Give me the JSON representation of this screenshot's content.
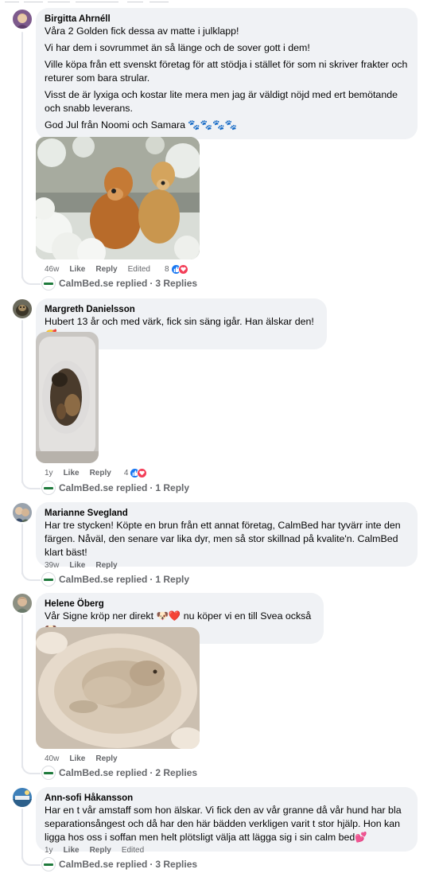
{
  "colors": {
    "bubble": "#f0f2f5",
    "meta": "#65676b",
    "like_blue": "#1877f2",
    "love_red": "#f33e58",
    "brand_green": "#1f7a3c"
  },
  "comments": [
    {
      "author": "Birgitta Ahrnéll",
      "paragraphs": [
        "Våra 2 Golden fick dessa av matte i julklapp!",
        "Vi har dem i sovrummet än så länge och de sover gott i dem!",
        "Ville köpa från ett svenskt företag för att stödja i stället för som ni skriver frakter och returer som bara strular.",
        "Visst de är lyxiga och kostar lite mera men jag är väldigt nöjd med ert bemötande och snabb leverans.",
        "God Jul från Noomi och Samara 🐾🐾🐾🐾"
      ],
      "photo": "two-golden-retrievers-in-snow",
      "age": "46w",
      "like": "Like",
      "reply": "Reply",
      "edited": "Edited",
      "reactions": "8",
      "replied_by": "CalmBed.se replied",
      "replies": "3 Replies"
    },
    {
      "author": "Margreth Danielsson",
      "paragraphs": [
        "Hubert 13 år och med värk, fick sin säng igår. Han älskar den!🥰"
      ],
      "photo": "dog-sleeping-on-bed",
      "age": "1y",
      "like": "Like",
      "reply": "Reply",
      "reactions": "4",
      "replied_by": "CalmBed.se replied",
      "replies": "1 Reply"
    },
    {
      "author": "Marianne Svegland",
      "paragraphs": [
        "Har tre stycken! Köpte en brun från ett annat företag, CalmBed har tyvärr inte den färgen. Nåväl, den senare var lika dyr, men så stor skillnad på kvalite'n. CalmBed klart bäst!"
      ],
      "age": "39w",
      "like": "Like",
      "reply": "Reply",
      "replied_by": "CalmBed.se replied",
      "replies": "1 Reply"
    },
    {
      "author": "Helene Öberg",
      "paragraphs": [
        "Vår Signe kröp ner direkt 🐶❤️ nu köper vi en till Svea också 🐶"
      ],
      "photo": "fluffy-dog-in-round-bed",
      "age": "40w",
      "like": "Like",
      "reply": "Reply",
      "replied_by": "CalmBed.se replied",
      "replies": "2 Replies"
    },
    {
      "author": "Ann-sofi Håkansson",
      "paragraphs": [
        "Har en t vår amstaff som hon älskar. Vi fick den av vår granne då vår hund har bla separationsångest och då har den här bädden verkligen varit t stor hjälp. Hon kan ligga hos oss i soffan men helt plötsligt välja att lägga sig i sin calm bed💕"
      ],
      "age": "1y",
      "like": "Like",
      "reply": "Reply",
      "edited": "Edited",
      "replied_by": "CalmBed.se replied",
      "replies": "3 Replies"
    }
  ]
}
